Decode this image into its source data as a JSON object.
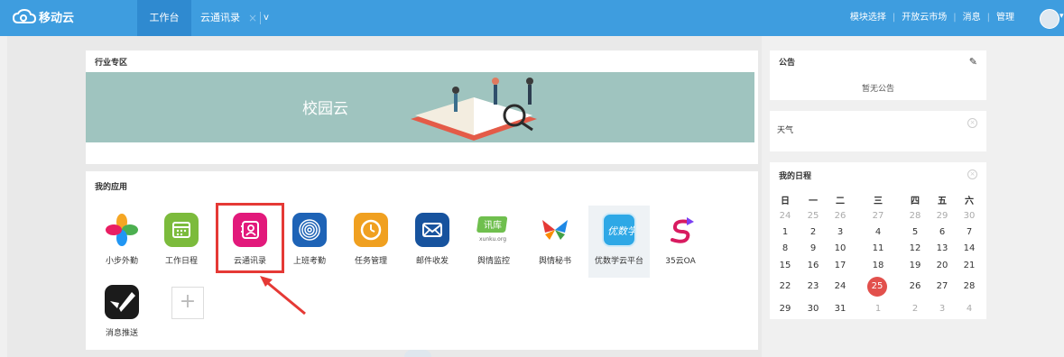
{
  "topbar": {
    "logo_text": "移动云",
    "tabs": [
      {
        "label": "工作台"
      },
      {
        "label": "云通讯录"
      }
    ],
    "tab_close": "×",
    "tab_dropdown": "v",
    "nav": [
      {
        "label": "模块选择"
      },
      {
        "label": "开放云市场"
      },
      {
        "label": "消息"
      },
      {
        "label": "管理"
      }
    ],
    "nav_separator": "|",
    "accent": "#3e9ddf"
  },
  "industry": {
    "title": "行业专区",
    "banner_text": "校园云"
  },
  "apps": {
    "title": "我的应用",
    "items": [
      {
        "label": "小步外勤",
        "icon": "pinwheel-icon"
      },
      {
        "label": "工作日程",
        "icon": "calendar-icon"
      },
      {
        "label": "云通讯录",
        "icon": "contacts-icon"
      },
      {
        "label": "上班考勤",
        "icon": "fingerprint-icon"
      },
      {
        "label": "任务管理",
        "icon": "clock-icon"
      },
      {
        "label": "邮件收发",
        "icon": "mail-icon"
      },
      {
        "label": "舆情监控",
        "icon": "xunku-icon",
        "sub": "xunku.org",
        "badge": "讯库"
      },
      {
        "label": "舆情秘书",
        "icon": "butterfly-icon"
      },
      {
        "label": "优数学云平台",
        "icon": "youshuxue-icon",
        "badge": "优数学"
      },
      {
        "label": "35云OA",
        "icon": "s-arrow-icon"
      },
      {
        "label": "消息推送",
        "icon": "push-icon"
      }
    ],
    "add_label": "+"
  },
  "notice": {
    "title": "公告",
    "empty_text": "暂无公告"
  },
  "weather": {
    "title": "天气"
  },
  "calendar": {
    "title": "我的日程",
    "weekdays": [
      "日",
      "一",
      "二",
      "三",
      "四",
      "五",
      "六"
    ],
    "rows": [
      [
        "24",
        "25",
        "26",
        "27",
        "28",
        "29",
        "30"
      ],
      [
        "1",
        "2",
        "3",
        "4",
        "5",
        "6",
        "7"
      ],
      [
        "8",
        "9",
        "10",
        "11",
        "12",
        "13",
        "14"
      ],
      [
        "15",
        "16",
        "17",
        "18",
        "19",
        "20",
        "21"
      ],
      [
        "22",
        "23",
        "24",
        "25",
        "26",
        "27",
        "28"
      ],
      [
        "29",
        "30",
        "31",
        "1",
        "2",
        "3",
        "4"
      ]
    ],
    "today": "25"
  }
}
